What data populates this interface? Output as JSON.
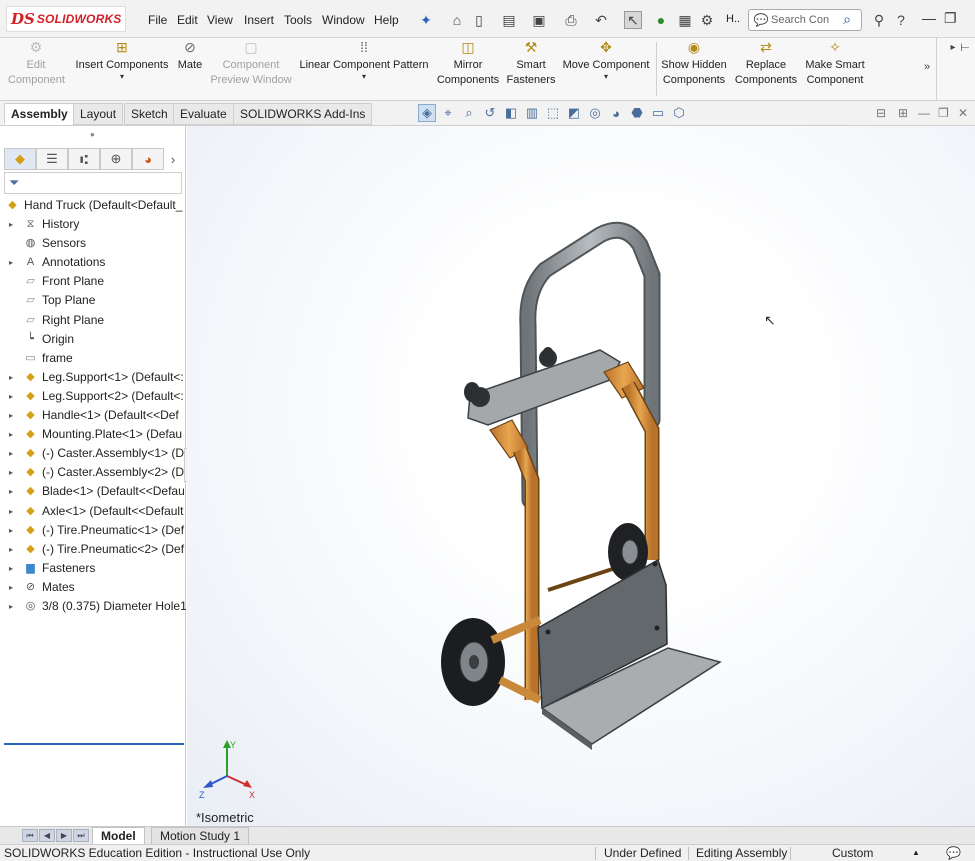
{
  "app": {
    "logo_ds": "DS",
    "logo_name": "SOLIDWORKS"
  },
  "menu": [
    "File",
    "Edit",
    "View",
    "Insert",
    "Tools",
    "Window",
    "Help"
  ],
  "quick_access": {
    "h_label": "H..",
    "search_placeholder": "Search Con"
  },
  "command_manager": {
    "edit_component": "Edit Component",
    "insert_components": "Insert Components",
    "mate": "Mate",
    "component_preview": "Component Preview Window",
    "linear_pattern": "Linear Component Pattern",
    "mirror_components": "Mirror Components",
    "smart_fasteners": "Smart Fasteners",
    "move_component": "Move Component",
    "show_hidden": "Show Hidden Components",
    "replace_components": "Replace Components",
    "make_smart_component": "Make Smart Component"
  },
  "tabs": [
    "Assembly",
    "Layout",
    "Sketch",
    "Evaluate",
    "SOLIDWORKS Add-Ins"
  ],
  "tree": {
    "root": "Hand Truck  (Default<Default_",
    "items": [
      {
        "label": "History",
        "expandable": true,
        "icon": "history-icon"
      },
      {
        "label": "Sensors",
        "expandable": false,
        "icon": "sensors-icon"
      },
      {
        "label": "Annotations",
        "expandable": true,
        "icon": "annotations-icon"
      },
      {
        "label": "Front Plane",
        "expandable": false,
        "icon": "plane-icon"
      },
      {
        "label": "Top Plane",
        "expandable": false,
        "icon": "plane-icon"
      },
      {
        "label": "Right Plane",
        "expandable": false,
        "icon": "plane-icon"
      },
      {
        "label": "Origin",
        "expandable": false,
        "icon": "origin-icon"
      },
      {
        "label": "frame",
        "expandable": false,
        "icon": "sketch-icon"
      },
      {
        "label": "Leg.Support<1> (Default<:",
        "expandable": true,
        "icon": "part-icon"
      },
      {
        "label": "Leg.Support<2> (Default<:",
        "expandable": true,
        "icon": "part-icon"
      },
      {
        "label": "Handle<1> (Default<<Def",
        "expandable": true,
        "icon": "part-icon"
      },
      {
        "label": "Mounting.Plate<1> (Defau",
        "expandable": true,
        "icon": "part-icon"
      },
      {
        "label": "(-) Caster.Assembly<1> (De",
        "expandable": true,
        "icon": "subassembly-icon"
      },
      {
        "label": "(-) Caster.Assembly<2> (De",
        "expandable": true,
        "icon": "subassembly-icon"
      },
      {
        "label": "Blade<1> (Default<<Defau",
        "expandable": true,
        "icon": "part-icon"
      },
      {
        "label": "Axle<1> (Default<<Default",
        "expandable": true,
        "icon": "part-icon"
      },
      {
        "label": "(-) Tire.Pneumatic<1> (Def",
        "expandable": true,
        "icon": "part-icon"
      },
      {
        "label": "(-) Tire.Pneumatic<2> (Def",
        "expandable": true,
        "icon": "part-icon"
      },
      {
        "label": "Fasteners",
        "expandable": true,
        "icon": "folder-icon"
      },
      {
        "label": "Mates",
        "expandable": true,
        "icon": "mates-icon"
      },
      {
        "label": "3/8 (0.375) Diameter Hole1",
        "expandable": true,
        "icon": "hole-icon"
      }
    ]
  },
  "viewport": {
    "view_label": "*Isometric",
    "triad_axes": {
      "x": "X",
      "y": "Y",
      "z": "Z"
    }
  },
  "bottom_tabs": [
    "Model",
    "Motion Study 1"
  ],
  "status": {
    "edition": "SOLIDWORKS Education Edition - Instructional Use Only",
    "definition": "Under Defined",
    "mode": "Editing Assembly",
    "units": "Custom"
  },
  "colors": {
    "frame_orange": "#d9953a",
    "handle_gray": "#8e9498",
    "plate_gray": "#6f7478",
    "accent_blue": "#2962b9",
    "logo_red": "#d32027"
  }
}
